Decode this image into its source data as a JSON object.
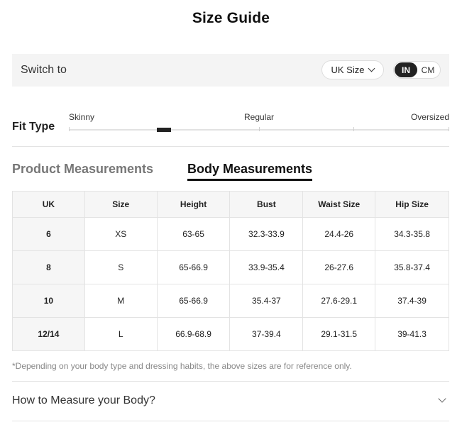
{
  "page": {
    "title": "Size Guide"
  },
  "switch_bar": {
    "label": "Switch to",
    "size_system": "UK Size",
    "units": {
      "active": "IN",
      "inactive": "CM"
    }
  },
  "fit_type": {
    "label": "Fit Type",
    "options": [
      "Skinny",
      "Regular",
      "Oversized"
    ],
    "selected_position_fraction": 0.25
  },
  "tabs": [
    {
      "label": "Product Measurements",
      "active": false
    },
    {
      "label": "Body Measurements",
      "active": true
    }
  ],
  "table": {
    "headers": [
      "UK",
      "Size",
      "Height",
      "Bust",
      "Waist Size",
      "Hip Size"
    ],
    "rows": [
      [
        "6",
        "XS",
        "63-65",
        "32.3-33.9",
        "24.4-26",
        "34.3-35.8"
      ],
      [
        "8",
        "S",
        "65-66.9",
        "33.9-35.4",
        "26-27.6",
        "35.8-37.4"
      ],
      [
        "10",
        "M",
        "65-66.9",
        "35.4-37",
        "27.6-29.1",
        "37.4-39"
      ],
      [
        "12/14",
        "L",
        "66.9-68.9",
        "37-39.4",
        "29.1-31.5",
        "39-41.3"
      ]
    ]
  },
  "note": "*Depending on your body type and dressing habits, the above sizes are for reference only.",
  "accordion": {
    "label": "How to Measure your Body?"
  },
  "colors": {
    "accent": "#222222",
    "header_bg": "#f6f6f6",
    "bar_bg": "#f4f4f4",
    "muted": "#888888"
  }
}
